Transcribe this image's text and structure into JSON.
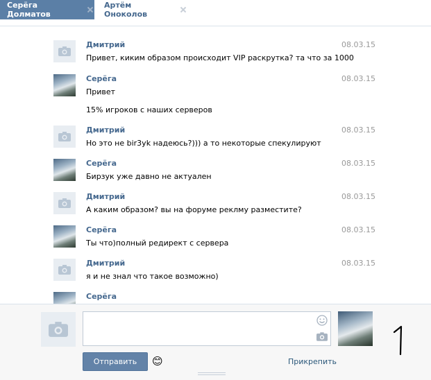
{
  "tabs": [
    {
      "label": "Серёга Долматов",
      "active": true
    },
    {
      "label": "Артём Оноколов",
      "active": false
    }
  ],
  "messages": [
    {
      "author": "Дмитрий",
      "date": "08.03.15",
      "lines": [
        "Привет, киким образом происходит VIP раскрутка? та что за 1000"
      ],
      "avatar": "camera-placeholder"
    },
    {
      "author": "Серёга",
      "date": "08.03.15",
      "lines": [
        "Привет",
        "15% игроков с наших серверов"
      ],
      "avatar": "photo"
    },
    {
      "author": "Дмитрий",
      "date": "08.03.15",
      "lines": [
        "Но это не bir3yk надеюсь?))) а то некоторые спекулируют"
      ],
      "avatar": "camera-placeholder"
    },
    {
      "author": "Серёга",
      "date": "08.03.15",
      "lines": [
        "Бирзук уже давно не актуален"
      ],
      "avatar": "photo"
    },
    {
      "author": "Дмитрий",
      "date": "08.03.15",
      "lines": [
        "А каким образом? вы на форуме реклму разместите?"
      ],
      "avatar": "camera-placeholder"
    },
    {
      "author": "Серёга",
      "date": "08.03.15",
      "lines": [
        "Ты что)полный редирект с сервера"
      ],
      "avatar": "photo"
    },
    {
      "author": "Дмитрий",
      "date": "08.03.15",
      "lines": [
        "я и не знал что такое возможно)"
      ],
      "avatar": "camera-placeholder"
    },
    {
      "author": "Серёга",
      "date": "",
      "lines": [],
      "avatar": "photo"
    }
  ],
  "composer": {
    "message_value": "",
    "send_label": "Отправить",
    "attach_label": "Прикрепить",
    "emoji": "😊"
  },
  "annotation": "1",
  "colors": {
    "accent": "#5b7fa6",
    "link": "#45688e",
    "date": "#999999"
  }
}
